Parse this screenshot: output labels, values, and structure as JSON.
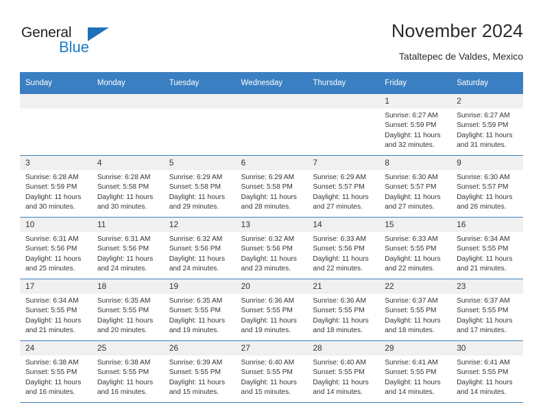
{
  "brand": {
    "name_part1": "General",
    "name_part2": "Blue",
    "triangle_color": "#1e71b8",
    "blue_color": "#1b7bc4"
  },
  "header": {
    "title": "November 2024",
    "subtitle": "Tataltepec de Valdes, Mexico"
  },
  "theme": {
    "header_bg": "#3a7fc1",
    "daynum_bg": "#f0f0f0",
    "text": "#333333"
  },
  "weekday_headers": [
    "Sunday",
    "Monday",
    "Tuesday",
    "Wednesday",
    "Thursday",
    "Friday",
    "Saturday"
  ],
  "weeks": [
    [
      {
        "day": "",
        "empty": true,
        "sunrise": "",
        "sunset": "",
        "daylight_line1": "",
        "daylight_line2": ""
      },
      {
        "day": "",
        "empty": true,
        "sunrise": "",
        "sunset": "",
        "daylight_line1": "",
        "daylight_line2": ""
      },
      {
        "day": "",
        "empty": true,
        "sunrise": "",
        "sunset": "",
        "daylight_line1": "",
        "daylight_line2": ""
      },
      {
        "day": "",
        "empty": true,
        "sunrise": "",
        "sunset": "",
        "daylight_line1": "",
        "daylight_line2": ""
      },
      {
        "day": "",
        "empty": true,
        "sunrise": "",
        "sunset": "",
        "daylight_line1": "",
        "daylight_line2": ""
      },
      {
        "day": "1",
        "empty": false,
        "sunrise": "Sunrise: 6:27 AM",
        "sunset": "Sunset: 5:59 PM",
        "daylight_line1": "Daylight: 11 hours",
        "daylight_line2": "and 32 minutes."
      },
      {
        "day": "2",
        "empty": false,
        "sunrise": "Sunrise: 6:27 AM",
        "sunset": "Sunset: 5:59 PM",
        "daylight_line1": "Daylight: 11 hours",
        "daylight_line2": "and 31 minutes."
      }
    ],
    [
      {
        "day": "3",
        "empty": false,
        "sunrise": "Sunrise: 6:28 AM",
        "sunset": "Sunset: 5:59 PM",
        "daylight_line1": "Daylight: 11 hours",
        "daylight_line2": "and 30 minutes."
      },
      {
        "day": "4",
        "empty": false,
        "sunrise": "Sunrise: 6:28 AM",
        "sunset": "Sunset: 5:58 PM",
        "daylight_line1": "Daylight: 11 hours",
        "daylight_line2": "and 30 minutes."
      },
      {
        "day": "5",
        "empty": false,
        "sunrise": "Sunrise: 6:29 AM",
        "sunset": "Sunset: 5:58 PM",
        "daylight_line1": "Daylight: 11 hours",
        "daylight_line2": "and 29 minutes."
      },
      {
        "day": "6",
        "empty": false,
        "sunrise": "Sunrise: 6:29 AM",
        "sunset": "Sunset: 5:58 PM",
        "daylight_line1": "Daylight: 11 hours",
        "daylight_line2": "and 28 minutes."
      },
      {
        "day": "7",
        "empty": false,
        "sunrise": "Sunrise: 6:29 AM",
        "sunset": "Sunset: 5:57 PM",
        "daylight_line1": "Daylight: 11 hours",
        "daylight_line2": "and 27 minutes."
      },
      {
        "day": "8",
        "empty": false,
        "sunrise": "Sunrise: 6:30 AM",
        "sunset": "Sunset: 5:57 PM",
        "daylight_line1": "Daylight: 11 hours",
        "daylight_line2": "and 27 minutes."
      },
      {
        "day": "9",
        "empty": false,
        "sunrise": "Sunrise: 6:30 AM",
        "sunset": "Sunset: 5:57 PM",
        "daylight_line1": "Daylight: 11 hours",
        "daylight_line2": "and 26 minutes."
      }
    ],
    [
      {
        "day": "10",
        "empty": false,
        "sunrise": "Sunrise: 6:31 AM",
        "sunset": "Sunset: 5:56 PM",
        "daylight_line1": "Daylight: 11 hours",
        "daylight_line2": "and 25 minutes."
      },
      {
        "day": "11",
        "empty": false,
        "sunrise": "Sunrise: 6:31 AM",
        "sunset": "Sunset: 5:56 PM",
        "daylight_line1": "Daylight: 11 hours",
        "daylight_line2": "and 24 minutes."
      },
      {
        "day": "12",
        "empty": false,
        "sunrise": "Sunrise: 6:32 AM",
        "sunset": "Sunset: 5:56 PM",
        "daylight_line1": "Daylight: 11 hours",
        "daylight_line2": "and 24 minutes."
      },
      {
        "day": "13",
        "empty": false,
        "sunrise": "Sunrise: 6:32 AM",
        "sunset": "Sunset: 5:56 PM",
        "daylight_line1": "Daylight: 11 hours",
        "daylight_line2": "and 23 minutes."
      },
      {
        "day": "14",
        "empty": false,
        "sunrise": "Sunrise: 6:33 AM",
        "sunset": "Sunset: 5:56 PM",
        "daylight_line1": "Daylight: 11 hours",
        "daylight_line2": "and 22 minutes."
      },
      {
        "day": "15",
        "empty": false,
        "sunrise": "Sunrise: 6:33 AM",
        "sunset": "Sunset: 5:55 PM",
        "daylight_line1": "Daylight: 11 hours",
        "daylight_line2": "and 22 minutes."
      },
      {
        "day": "16",
        "empty": false,
        "sunrise": "Sunrise: 6:34 AM",
        "sunset": "Sunset: 5:55 PM",
        "daylight_line1": "Daylight: 11 hours",
        "daylight_line2": "and 21 minutes."
      }
    ],
    [
      {
        "day": "17",
        "empty": false,
        "sunrise": "Sunrise: 6:34 AM",
        "sunset": "Sunset: 5:55 PM",
        "daylight_line1": "Daylight: 11 hours",
        "daylight_line2": "and 21 minutes."
      },
      {
        "day": "18",
        "empty": false,
        "sunrise": "Sunrise: 6:35 AM",
        "sunset": "Sunset: 5:55 PM",
        "daylight_line1": "Daylight: 11 hours",
        "daylight_line2": "and 20 minutes."
      },
      {
        "day": "19",
        "empty": false,
        "sunrise": "Sunrise: 6:35 AM",
        "sunset": "Sunset: 5:55 PM",
        "daylight_line1": "Daylight: 11 hours",
        "daylight_line2": "and 19 minutes."
      },
      {
        "day": "20",
        "empty": false,
        "sunrise": "Sunrise: 6:36 AM",
        "sunset": "Sunset: 5:55 PM",
        "daylight_line1": "Daylight: 11 hours",
        "daylight_line2": "and 19 minutes."
      },
      {
        "day": "21",
        "empty": false,
        "sunrise": "Sunrise: 6:36 AM",
        "sunset": "Sunset: 5:55 PM",
        "daylight_line1": "Daylight: 11 hours",
        "daylight_line2": "and 18 minutes."
      },
      {
        "day": "22",
        "empty": false,
        "sunrise": "Sunrise: 6:37 AM",
        "sunset": "Sunset: 5:55 PM",
        "daylight_line1": "Daylight: 11 hours",
        "daylight_line2": "and 18 minutes."
      },
      {
        "day": "23",
        "empty": false,
        "sunrise": "Sunrise: 6:37 AM",
        "sunset": "Sunset: 5:55 PM",
        "daylight_line1": "Daylight: 11 hours",
        "daylight_line2": "and 17 minutes."
      }
    ],
    [
      {
        "day": "24",
        "empty": false,
        "sunrise": "Sunrise: 6:38 AM",
        "sunset": "Sunset: 5:55 PM",
        "daylight_line1": "Daylight: 11 hours",
        "daylight_line2": "and 16 minutes."
      },
      {
        "day": "25",
        "empty": false,
        "sunrise": "Sunrise: 6:38 AM",
        "sunset": "Sunset: 5:55 PM",
        "daylight_line1": "Daylight: 11 hours",
        "daylight_line2": "and 16 minutes."
      },
      {
        "day": "26",
        "empty": false,
        "sunrise": "Sunrise: 6:39 AM",
        "sunset": "Sunset: 5:55 PM",
        "daylight_line1": "Daylight: 11 hours",
        "daylight_line2": "and 15 minutes."
      },
      {
        "day": "27",
        "empty": false,
        "sunrise": "Sunrise: 6:40 AM",
        "sunset": "Sunset: 5:55 PM",
        "daylight_line1": "Daylight: 11 hours",
        "daylight_line2": "and 15 minutes."
      },
      {
        "day": "28",
        "empty": false,
        "sunrise": "Sunrise: 6:40 AM",
        "sunset": "Sunset: 5:55 PM",
        "daylight_line1": "Daylight: 11 hours",
        "daylight_line2": "and 14 minutes."
      },
      {
        "day": "29",
        "empty": false,
        "sunrise": "Sunrise: 6:41 AM",
        "sunset": "Sunset: 5:55 PM",
        "daylight_line1": "Daylight: 11 hours",
        "daylight_line2": "and 14 minutes."
      },
      {
        "day": "30",
        "empty": false,
        "sunrise": "Sunrise: 6:41 AM",
        "sunset": "Sunset: 5:55 PM",
        "daylight_line1": "Daylight: 11 hours",
        "daylight_line2": "and 14 minutes."
      }
    ]
  ]
}
